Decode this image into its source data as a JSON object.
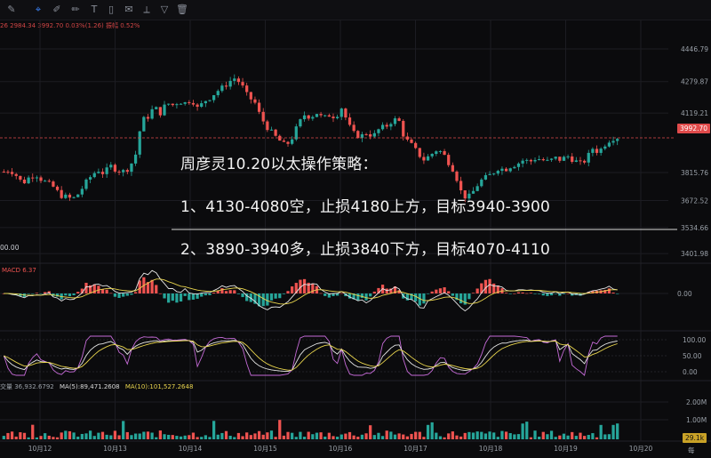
{
  "toolbar": {
    "icons": [
      "pencil-icon",
      "crosshair-icon",
      "pen-icon",
      "brush-icon",
      "text-icon",
      "rectangle-icon",
      "note-icon",
      "ruler-icon",
      "filter-icon",
      "trash-icon"
    ]
  },
  "header": {
    "ohlc_text": "26  2984.34  3992.70  0.03%(1.26)  振幅 0.52%"
  },
  "annotation": {
    "title": "周彦灵10.20以太操作策略：",
    "line1": "1、4130-4080空，止损4180上方，目标3940-3900",
    "line2": "2、3890-3940多，止损3840下方，目标4070-4110"
  },
  "price_panel": {
    "left_value": "00.00",
    "current_price_tag": "3992.70"
  },
  "macd_panel": {
    "label": "MACD 6.37"
  },
  "volume_panel": {
    "label_prefix": "交量 36,932.6792",
    "ma5": "MA(5):89,471.2608",
    "ma10": "MA(10):101,527.2648",
    "current_tag": "29.1k"
  },
  "colors": {
    "up": "#26a69a",
    "down": "#ef5350",
    "ma_yellow": "#e8d44d",
    "ma_purple": "#c46ad6",
    "ma_white": "#e6e6e6",
    "price_line": "#e04b4b",
    "grid": "#1c1c22"
  },
  "chart_data": [
    {
      "type": "candlestick",
      "name": "price",
      "x_ticks": [
        "10月12",
        "10月13",
        "10月14",
        "10月15",
        "10月16",
        "10月17",
        "10月18",
        "10月19",
        "10月20"
      ],
      "y_ticks": [
        4446.79,
        4279.87,
        4119.21,
        3992.7,
        3815.76,
        3672.52,
        3534.66,
        3401.98
      ],
      "ylim": [
        3380,
        4560
      ],
      "path": [
        3820,
        3830,
        3800,
        3760,
        3790,
        3810,
        3780,
        3760,
        3740,
        3700,
        3690,
        3680,
        3710,
        3760,
        3800,
        3830,
        3810,
        3850,
        3830,
        3820,
        3840,
        3900,
        4080,
        4100,
        4150,
        4120,
        4170,
        4160,
        4180,
        4170,
        4190,
        4140,
        4180,
        4200,
        4230,
        4250,
        4280,
        4300,
        4260,
        4200,
        4180,
        4100,
        4050,
        4010,
        3980,
        3950,
        3990,
        4060,
        4110,
        4100,
        4120,
        4090,
        4110,
        4100,
        4150,
        4060,
        4010,
        4000,
        4020,
        4000,
        4040,
        4050,
        4080,
        4090,
        3990,
        3960,
        3920,
        3880,
        3900,
        3930,
        3920,
        3870,
        3820,
        3720,
        3680,
        3720,
        3770,
        3790,
        3810,
        3840,
        3830,
        3850,
        3860,
        3880,
        3870,
        3890,
        3880,
        3870,
        3890,
        3880,
        3900,
        3880,
        3860,
        3880,
        3940,
        3920,
        3960,
        3990,
        3995
      ],
      "current_price": 3992.7
    },
    {
      "type": "line",
      "name": "MACD",
      "label": "MACD 6.37",
      "y_ticks": [
        0.0
      ]
    },
    {
      "type": "line",
      "name": "KDJ",
      "y_ticks": [
        100.0,
        50.0,
        0.0
      ]
    },
    {
      "type": "bar",
      "name": "Volume",
      "y_ticks": [
        "2.00M",
        "1.00M"
      ],
      "current": "29.1k"
    }
  ]
}
